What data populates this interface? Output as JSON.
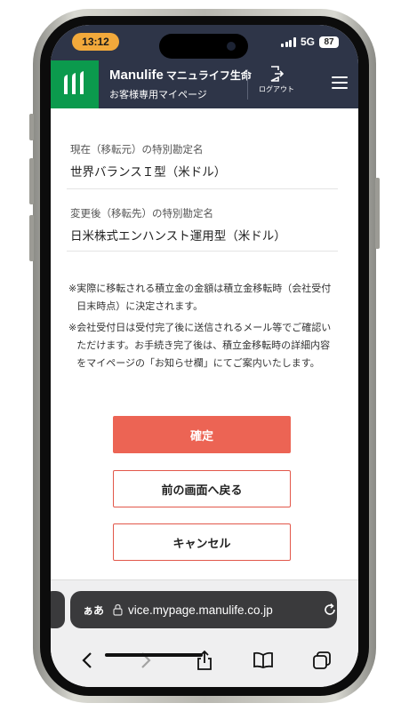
{
  "status_bar": {
    "time": "13:12",
    "network": "5G",
    "battery": "87"
  },
  "header": {
    "brand_name": "Manulife",
    "brand_jp": "マニュライフ生命",
    "subtitle": "お客様専用マイページ",
    "logout_label": "ログアウト",
    "logo_icon": "manulife-logo",
    "colors": {
      "header_bg": "#2e3548",
      "logo_green": "#0b9a4d"
    }
  },
  "form": {
    "current_account_label": "現在（移転元）の特別勘定名",
    "current_account_value": "世界バランスＩ型（米ドル）",
    "new_account_label": "変更後（移転先）の特別勘定名",
    "new_account_value": "日米株式エンハンスト運用型（米ドル）"
  },
  "notes": [
    {
      "mark": "※",
      "text": "実際に移転される積立金の金額は積立金移転時（会社受付日末時点）に決定されます。"
    },
    {
      "mark": "※",
      "text": "会社受付日は受付完了後に送信されるメール等でご確認いただけます。お手続き完了後は、積立金移転時の詳細内容をマイページの「お知らせ欄」にてご案内いたします。"
    }
  ],
  "buttons": {
    "confirm": "確定",
    "back": "前の画面へ戻る",
    "cancel": "キャンセル",
    "colors": {
      "confirm_bg": "#ec6454",
      "outline": "#e2574a"
    }
  },
  "browser": {
    "text_size_button": "ぁあ",
    "url": "vice.mypage.manulife.co.jp",
    "nav_icons": [
      "back-arrow-icon",
      "forward-arrow-icon",
      "share-icon",
      "bookmarks-icon",
      "tabs-icon"
    ]
  }
}
